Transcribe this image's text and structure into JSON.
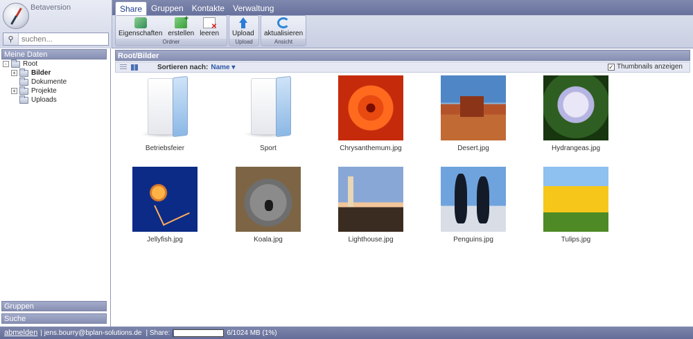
{
  "app": {
    "beta_label": "Betaversion"
  },
  "search": {
    "placeholder": "suchen..."
  },
  "tabs": [
    {
      "label": "Share",
      "active": true
    },
    {
      "label": "Gruppen",
      "active": false
    },
    {
      "label": "Kontakte",
      "active": false
    },
    {
      "label": "Verwaltung",
      "active": false
    }
  ],
  "ribbon": {
    "groups": [
      {
        "label": "Ordner",
        "buttons": [
          "Eigenschaften",
          "erstellen",
          "leeren"
        ]
      },
      {
        "label": "Upload",
        "buttons": [
          "Upload"
        ]
      },
      {
        "label": "Ansicht",
        "buttons": [
          "aktualisieren"
        ]
      }
    ]
  },
  "sidebar": {
    "my_data": "Meine Daten",
    "groups": "Gruppen",
    "search": "Suche",
    "tree": [
      {
        "label": "Root",
        "level": 0,
        "expander": "-",
        "bold": false
      },
      {
        "label": "Bilder",
        "level": 1,
        "expander": "+",
        "bold": true
      },
      {
        "label": "Dokumente",
        "level": 1,
        "expander": "",
        "bold": false
      },
      {
        "label": "Projekte",
        "level": 1,
        "expander": "+",
        "bold": false
      },
      {
        "label": "Uploads",
        "level": 1,
        "expander": "",
        "bold": false
      }
    ]
  },
  "main": {
    "path": "Root/Bilder",
    "sort_label": "Sortieren nach:",
    "sort_value": "Name ▾",
    "thumbnails_label": "Thumbnails anzeigen",
    "thumbnails_checked": true,
    "items": [
      {
        "name": "Betriebsfeier",
        "kind": "folder",
        "image": "folder"
      },
      {
        "name": "Sport",
        "kind": "folder",
        "image": "folder"
      },
      {
        "name": "Chrysanthemum.jpg",
        "kind": "image",
        "image": "img-chry"
      },
      {
        "name": "Desert.jpg",
        "kind": "image",
        "image": "img-desert"
      },
      {
        "name": "Hydrangeas.jpg",
        "kind": "image",
        "image": "img-hydr"
      },
      {
        "name": "Jellyfish.jpg",
        "kind": "image",
        "image": "img-jelly"
      },
      {
        "name": "Koala.jpg",
        "kind": "image",
        "image": "img-koala"
      },
      {
        "name": "Lighthouse.jpg",
        "kind": "image",
        "image": "img-light"
      },
      {
        "name": "Penguins.jpg",
        "kind": "image",
        "image": "img-peng"
      },
      {
        "name": "Tulips.jpg",
        "kind": "image",
        "image": "img-tulip"
      }
    ]
  },
  "footer": {
    "logout": "abmelden",
    "user": "| jens.bourry@bplan-solutions.de",
    "share_label": "| Share:",
    "quota_text": "6/1024 MB (1%)",
    "quota_fraction": 0.01
  }
}
